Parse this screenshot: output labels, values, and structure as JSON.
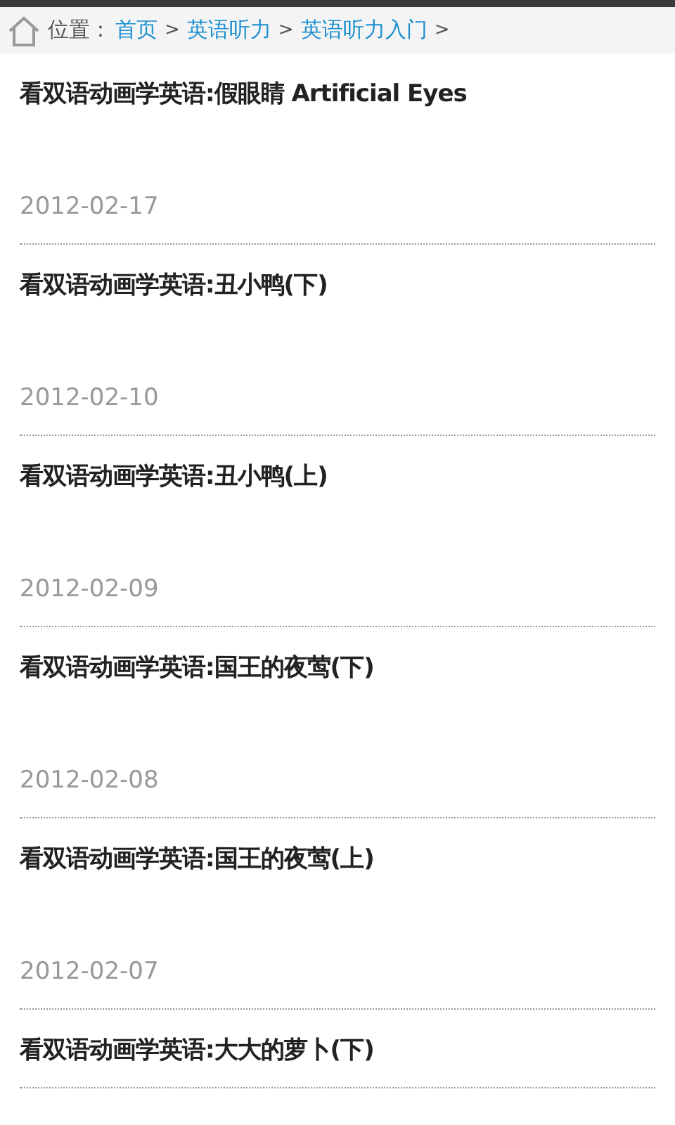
{
  "breadcrumb": {
    "label": "位置：",
    "links": [
      {
        "text": "首页",
        "separator": ">"
      },
      {
        "text": "英语听力",
        "separator": ">"
      },
      {
        "text": "英语听力入门",
        "separator": ">"
      }
    ]
  },
  "articles": [
    {
      "title": "看双语动画学英语:假眼睛 Artificial Eyes",
      "date": "2012-02-17"
    },
    {
      "title": "看双语动画学英语:丑小鸭(下)",
      "date": "2012-02-10"
    },
    {
      "title": "看双语动画学英语:丑小鸭(上)",
      "date": "2012-02-09"
    },
    {
      "title": "看双语动画学英语:国王的夜莺(下)",
      "date": "2012-02-08"
    },
    {
      "title": "看双语动画学英语:国王的夜莺(上)",
      "date": "2012-02-07"
    },
    {
      "title": "看双语动画学英语:大大的萝卜(下)"
    }
  ]
}
